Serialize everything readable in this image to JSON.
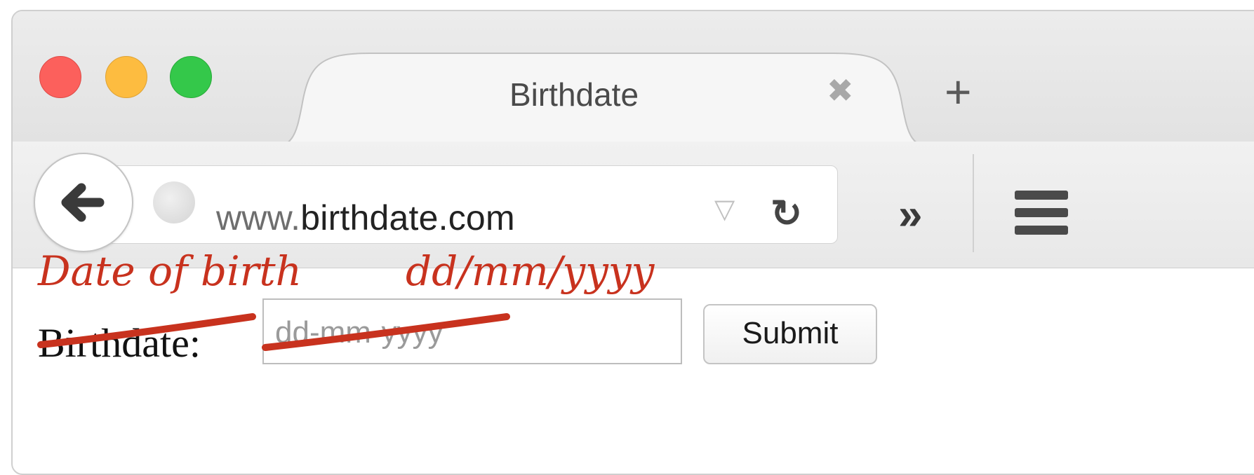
{
  "browser": {
    "tab_title": "Birthdate",
    "tab_close_glyph": "✖",
    "new_tab_glyph": "+",
    "url_prefix": "www.",
    "url_host": "birthdate.com",
    "back_glyph": "⬅",
    "dropdown_glyph": "▽",
    "reload_glyph": "↻",
    "overflow_glyph": "»",
    "icons": {
      "close": "close-icon",
      "new_tab": "plus-icon",
      "back": "back-arrow-icon",
      "site": "globe-icon",
      "dropdown": "dropdown-triangle-icon",
      "reload": "reload-icon",
      "overflow": "double-chevron-icon",
      "menu": "hamburger-menu-icon"
    },
    "traffic_lights": {
      "close_color": "#fc605c",
      "minimize_color": "#fdbc40",
      "zoom_color": "#34c84a"
    }
  },
  "page": {
    "label": "Birthdate:",
    "input_placeholder": "dd-mm-yyyy",
    "submit_label": "Submit"
  },
  "annotations": {
    "label_correction": "Date of birth",
    "format_correction": "dd/mm/yyyy",
    "color": "#c8321e"
  }
}
